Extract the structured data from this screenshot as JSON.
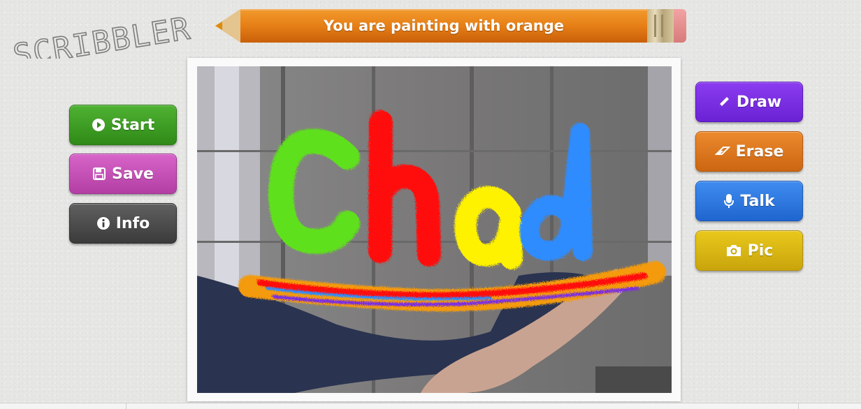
{
  "app": {
    "logo_text": "SCRIBBLER",
    "status_text": "You are painting with orange",
    "current_color": "#e67f16"
  },
  "left_buttons": {
    "start": {
      "label": "Start",
      "icon": "play-circle-icon",
      "color": "#3a9a22"
    },
    "save": {
      "label": "Save",
      "icon": "floppy-disk-icon",
      "color": "#c550b5"
    },
    "info": {
      "label": "Info",
      "icon": "info-circle-icon",
      "color": "#4a4a4a"
    }
  },
  "right_buttons": {
    "draw": {
      "label": "Draw",
      "icon": "pencil-icon",
      "color": "#7a2fe0"
    },
    "erase": {
      "label": "Erase",
      "icon": "eraser-icon",
      "color": "#dc7620"
    },
    "talk": {
      "label": "Talk",
      "icon": "microphone-icon",
      "color": "#2f78e0"
    },
    "pic": {
      "label": "Pic",
      "icon": "camera-icon",
      "color": "#d9b614"
    }
  },
  "canvas": {
    "drawn_text": "Chad",
    "letter_colors": [
      "#5fe01e",
      "#ff1010",
      "#fff200",
      "#2e8cff"
    ]
  }
}
